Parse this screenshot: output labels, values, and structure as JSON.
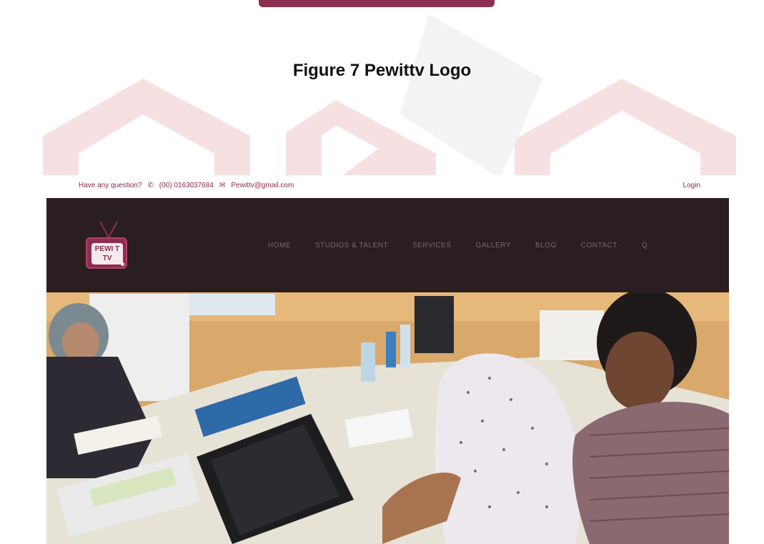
{
  "caption": "Figure 7 Pewittv Logo",
  "website": {
    "topbar": {
      "question_text": "Have any question?",
      "phone": "(00) 0163037684",
      "email": "Pewittv@gmail.com",
      "login_label": "Login"
    },
    "logo": {
      "line1": "PEWI T",
      "line2": "TV"
    },
    "nav_items": [
      "HOME",
      "STUDIOS & TALENT",
      "SERVICES",
      "GALLERY",
      "BLOG",
      "CONTACT",
      "Q"
    ],
    "hero_image": "classroom-photo"
  },
  "colors": {
    "brand": "#8c2e4f",
    "navbar_bg": "#2b1e20",
    "topbar_text": "#8a2a4c"
  },
  "icons": [
    "phone-icon",
    "mail-icon",
    "tv-antenna-icon",
    "search-icon"
  ]
}
